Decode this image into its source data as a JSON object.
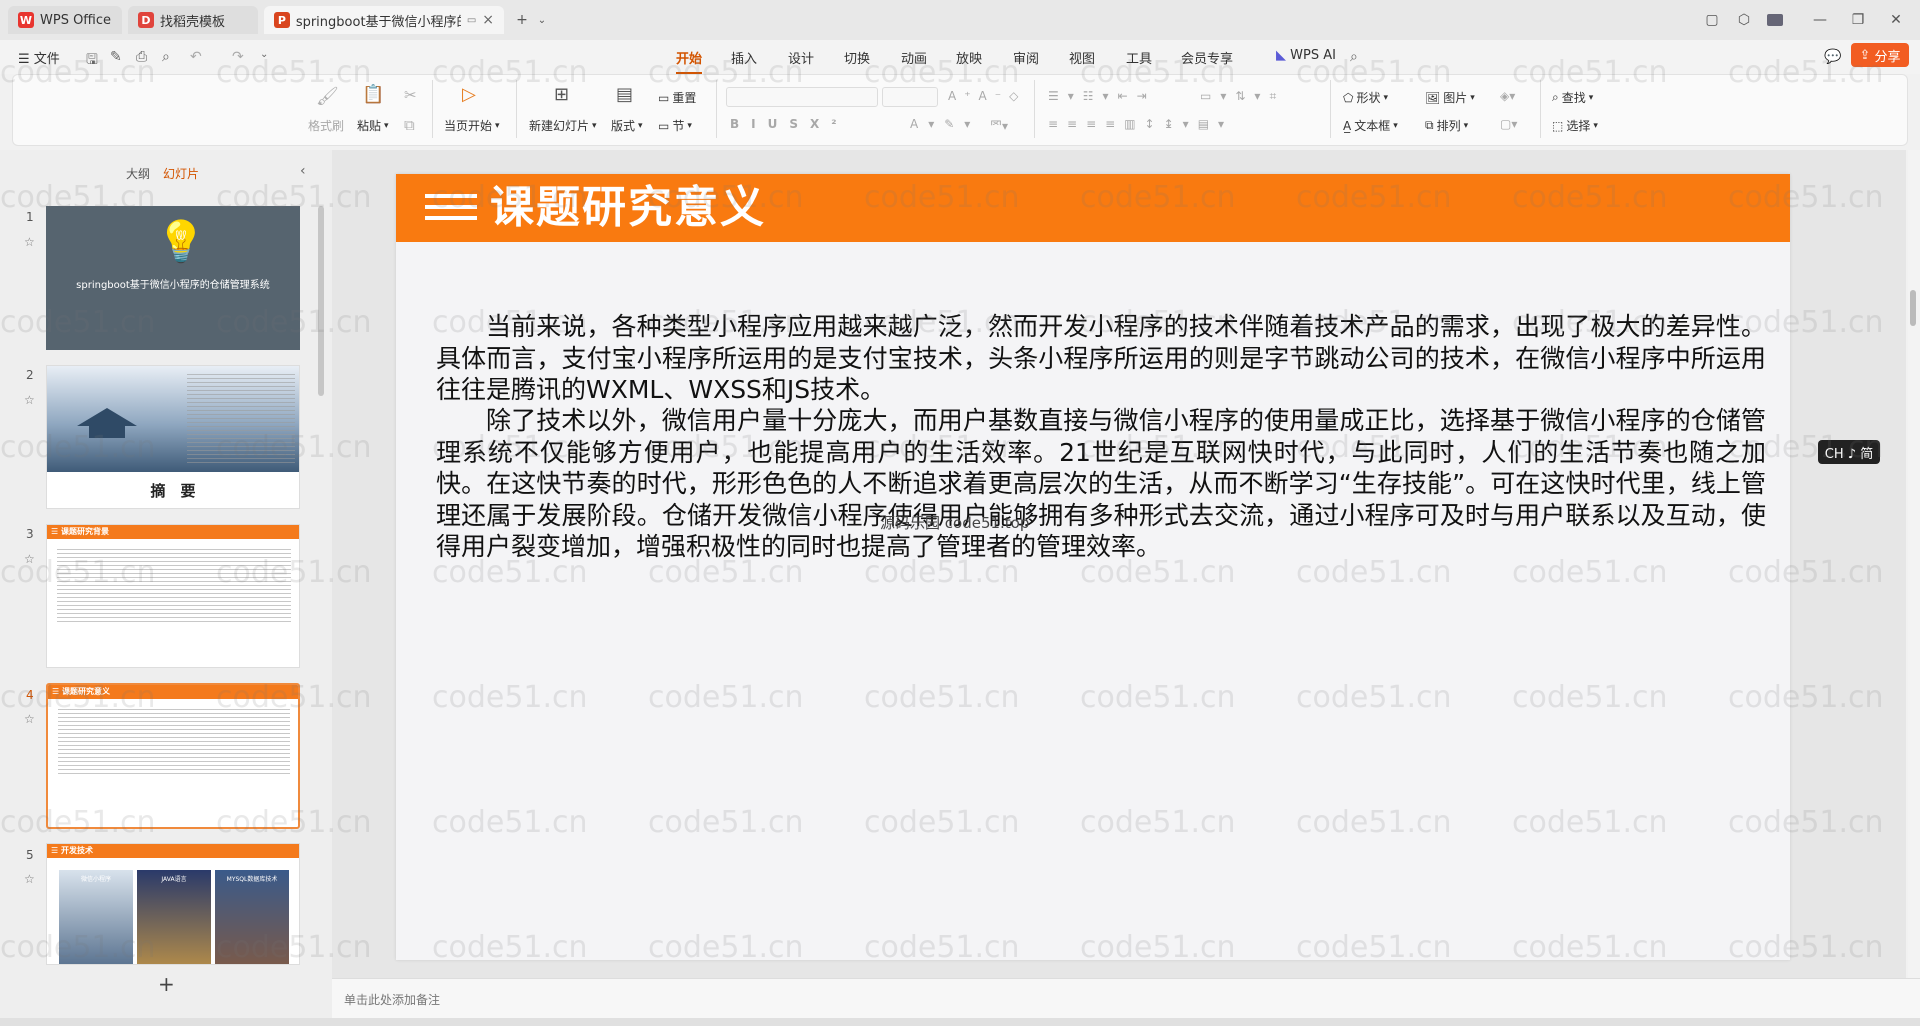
{
  "tabs": [
    {
      "label": "WPS Office",
      "logo": "W"
    },
    {
      "label": "找稻壳模板",
      "logo": "D"
    },
    {
      "label": "springboot基于微信小程序的",
      "logo": "P"
    }
  ],
  "menu": {
    "file": "文件",
    "items": [
      "开始",
      "插入",
      "设计",
      "切换",
      "动画",
      "放映",
      "审阅",
      "视图",
      "工具",
      "会员专享"
    ],
    "active": "开始",
    "wps_ai": "WPS AI",
    "share": "分享"
  },
  "ribbon": {
    "format_painter": "格式刷",
    "paste": "粘贴",
    "play_current": "当页开始",
    "new_slide": "新建幻灯片",
    "layout": "版式",
    "section": "节",
    "reset": "重置",
    "shape": "形状",
    "picture": "图片",
    "textbox": "文本框",
    "arrange": "排列",
    "find": "查找",
    "select": "选择"
  },
  "panel": {
    "outline_tab": "大纲",
    "slides_tab": "幻灯片",
    "add_button": "+"
  },
  "thumbnails": [
    {
      "num": "1",
      "title": "springboot基于微信小程序的仓储管理系统"
    },
    {
      "num": "2",
      "title": "摘　要"
    },
    {
      "num": "3",
      "title": "课题研究背景"
    },
    {
      "num": "4",
      "title": "课题研究意义"
    },
    {
      "num": "5",
      "title": "开发技术",
      "captions": [
        "微信小程序",
        "JAVA语言",
        "MYSQL数据库技术"
      ]
    }
  ],
  "slide": {
    "title": "课题研究意义",
    "paragraph1": "当前来说，各种类型小程序应用越来越广泛，然而开发小程序的技术伴随着技术产品的需求，出现了极大的差异性。具体而言，支付宝小程序所运用的是支付宝技术，头条小程序所运用的则是字节跳动公司的技术，在微信小程序中所运用往往是腾讯的WXML、WXSS和JS技术。",
    "paragraph2": "除了技术以外，微信用户量十分庞大，而用户基数直接与微信小程序的使用量成正比，选择基于微信小程序的仓储管理系统不仅能够方便用户，也能提高用户的生活效率。21世纪是互联网快时代，与此同时，人们的生活节奏也随之加快。在这快节奏的时代，形形色色的人不断追求着更高层次的生活，从而不断学习“生存技能”。可在这快时代里，线上管理还属于发展阶段。仓储开发微信小程序使得用户能够拥有多种形式去交流，通过小程序可及时与用户联系以及互动，使得用户裂变增加，增强积极性的同时也提高了管理者的管理效率。",
    "inline_watermark": "源码乐园 code51.top"
  },
  "notes_placeholder": "单击此处添加备注",
  "ime_badge": "CH ♪ 简",
  "watermark_text": "code51.cn",
  "colors": {
    "accent": "#d35400",
    "slide_bar": "#f97a10",
    "share": "#f25d22"
  }
}
